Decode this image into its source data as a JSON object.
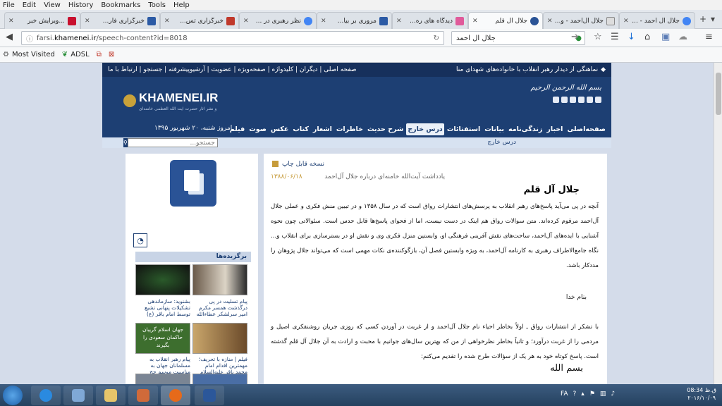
{
  "browser": {
    "menu": [
      "File",
      "Edit",
      "View",
      "History",
      "Bookmarks",
      "Tools",
      "Help"
    ],
    "tabs": [
      {
        "title": "...ویرایش خبر",
        "color": "#c8102e"
      },
      {
        "title": "خبرگزاری فار...",
        "color": "#2b5aa5"
      },
      {
        "title": "خبرگزاری تس...",
        "color": "#c0392b"
      },
      {
        "title": "نظر رهبری در ...",
        "color": "#4285f4"
      },
      {
        "title": "مروری بر بیا...",
        "color": "#2b5aa5"
      },
      {
        "title": "دیدگاه های ره...",
        "color": "#e05a9a"
      },
      {
        "title": "جلال آل قلم",
        "color": "#2a5396"
      },
      {
        "title": "جلال آل‌احمد - و...",
        "color": "#888888"
      },
      {
        "title": "جلال ال احمد - ...",
        "color": "#4285f4"
      }
    ],
    "url_prefix": "farsi.",
    "url_domain": "khamenei.ir",
    "url_path": "/speech-content?id=8018",
    "search_value": "جلال ال احمد",
    "bookmarks": [
      "Most Visited",
      "ADSL"
    ]
  },
  "site": {
    "top_notice": "نماهنگی از دیدار رهبر انقلاب با خانواده‌های شهدای منا",
    "top_links": "صفحه اصلی | دیگران | کلیدواژه | صفحه‌ویژه | عضویت | آرشیو‌پیشرفته | جستجو | ارتباط با ما",
    "logo": "KHAMENEI.IR",
    "logo_sub": "دفتر حفظ و نشر آثار حضرت آیت الله العظمی خامنه‌ای",
    "basmala": "بسم الله الرحمن الرحیم",
    "date": "امروز شنبه، ۲۰ شهریور ۱۳۹۵",
    "nav": [
      "صفحه‌اصلی",
      "اخبار",
      "زندگی‌نامه",
      "بیانات",
      "استفتائات",
      "درس خارج",
      "شرح حدیث",
      "خاطرات",
      "اشعار",
      "کتاب",
      "عکس",
      "صوت",
      "فیلم"
    ],
    "nav_selected": "درس خارج",
    "search_placeholder": "جستجو...",
    "breadcrumb": "درس خارج"
  },
  "sidebar": {
    "featured_title": "برگزیده‌ها",
    "items": [
      {
        "caption": "پیام تسلیت در پی درگذشت همسر مکرم امیر سرلشکر عطاءالله",
        "color": "#8a7a6a"
      },
      {
        "caption": "بشنوید: سازماندهی تشکیلات پنهانی تشیع توسط امام باقر (ع)",
        "color": "#2a2a2a"
      },
      {
        "caption": "فیلم | منازه با تحریف؛ مهمترین اقدام امام محمد باقر علیه‌السلام",
        "color": "#b08a4a"
      },
      {
        "caption": "پیام رهبر انقلاب به مسلمانان جهان به مناسبت موسم حج",
        "color": "#3a6b2a"
      }
    ],
    "item2_overlay": "جهان اسلام گریبان حاکمان سعودی را بگیرند"
  },
  "article": {
    "print_label": "نسخه قابل چاپ",
    "note": "یادداشت آیت‌الله خامنه‌ای درباره جلال آل‌احمد",
    "date": "۱۳۸۸/۰۶/۱۸",
    "title": "جلال آل قلم",
    "para1": "آنچه در پی می‌آید پاسخ‌های رهبر انقلاب به پرسش‌های انتشارات رواق است که در سال ۱۳۵۸ و در تبیین منش فکری و عملی جلال آل‌احمد مرقوم کرده‌اند. متن سوالات رواق هم اینک در دست نیست، اما از فحوای پاسخ‌ها قابل حدس است. سئوالاتی چون نحوه آشنایی با ایده‌های آل‌احمد، ساحت‌های نقش آفرینی فرهنگی او، وابستین منزل فکری وی و نقش او در بسترسازی برای انقلاب و... نگاه جامع‌الاطراف رهبری به کارنامه آل‌احمد، به ویژه وابستین فصل آن، بازگوکننده‌ی نکات مهمی است که می‌تواند جلال پژوهان را مددکار باشد.",
    "heading": "بنام خدا",
    "para2": "با تشکر از انتشارات رواق ـ اولاً بخاطر احیاء نام جلال آل‌احمد و از غربت در آوردن کسی که روزی جریان روشنفکری اصیل و مردمی را از غربت درآورد؛ و ثانیاً بخاطر نظرخواهی از من که بهترین سال‌های جوانیم با محبت و ارادت به آن جلال آل قلم گذشته است. پاسخ کوتاه خود به هر یک از سؤالات طرح شده را تقدیم می‌کنم:",
    "signature": "بسم‌ الله"
  },
  "taskbar": {
    "lang": "FA",
    "time": "08:34 ق.ظ",
    "date": "۲۰۱۶/۱۰/۰۹"
  }
}
